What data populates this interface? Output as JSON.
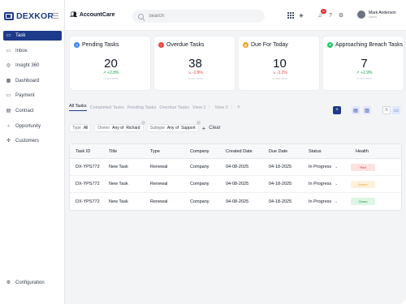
{
  "brand": {
    "name": "DEXKOR"
  },
  "sidebar": {
    "items": [
      {
        "label": "Task",
        "icon": "task-icon",
        "active": true
      },
      {
        "label": "Inbox",
        "icon": "inbox-icon"
      },
      {
        "label": "Insight 360",
        "icon": "insight-icon"
      },
      {
        "label": "Dashboard",
        "icon": "dashboard-icon"
      },
      {
        "label": "Payment",
        "icon": "payment-icon"
      },
      {
        "label": "Contract",
        "icon": "contract-icon"
      },
      {
        "label": "Opportunity",
        "icon": "opportunity-icon"
      },
      {
        "label": "Customers",
        "icon": "customers-icon"
      }
    ],
    "config_label": "Configuration"
  },
  "header": {
    "app_name": "AccountCare",
    "search_placeholder": "Search",
    "notification_count": "10",
    "user_name": "Mark Anderson",
    "user_role": "Admin"
  },
  "cards": [
    {
      "title": "Pending Tasks",
      "value": "20",
      "delta": "+2.8%",
      "subtitle": "vs last week",
      "color": "#3b82f6",
      "delta_color": "#16a34a"
    },
    {
      "title": "Overdue Tasks",
      "value": "38",
      "delta": "-2.8%",
      "subtitle": "vs last week",
      "color": "#ef4444",
      "delta_color": "#ef4444"
    },
    {
      "title": "Due For Today",
      "value": "10",
      "delta": "-3.2%",
      "subtitle": "vs last week",
      "color": "#f59e0b",
      "delta_color": "#ef4444"
    },
    {
      "title": "Approaching Breach Tasks",
      "value": "7",
      "delta": "+2.9%",
      "subtitle": "vs last week",
      "color": "#22c55e",
      "delta_color": "#16a34a"
    }
  ],
  "tabs": [
    "All Tasks",
    "Completed Tasks",
    "Pending Tasks",
    "Overdue Tasks",
    "View 1",
    "View 2"
  ],
  "filters": {
    "type_label": "Type",
    "type_value": "All",
    "owner_label": "Owner",
    "owner_op": "Any of",
    "owner_value": "Richard",
    "subtype_label": "Subtype",
    "subtype_op": "Any of",
    "subtype_value": "Support",
    "clear_label": "Clear"
  },
  "table": {
    "columns": [
      "Task ID",
      "Title",
      "Type",
      "Company",
      "Created Date",
      "Due Date",
      "Status",
      "Health"
    ],
    "rows": [
      {
        "id": "DX-YPS772",
        "title": "New Task",
        "type": "Renewal",
        "company": "Company",
        "created": "04-08-2025",
        "due": "04-18-2025",
        "status": "In Progress",
        "health": "Red"
      },
      {
        "id": "DX-YPS772",
        "title": "New Task",
        "type": "Renewal",
        "company": "Company",
        "created": "04-08-2025",
        "due": "04-18-2025",
        "status": "In Progress",
        "health": "Amber"
      },
      {
        "id": "DX-YPS772",
        "title": "New Task",
        "type": "Renewal",
        "company": "Company",
        "created": "04-08-2025",
        "due": "04-18-2025",
        "status": "In Progress",
        "health": "Green"
      }
    ]
  }
}
